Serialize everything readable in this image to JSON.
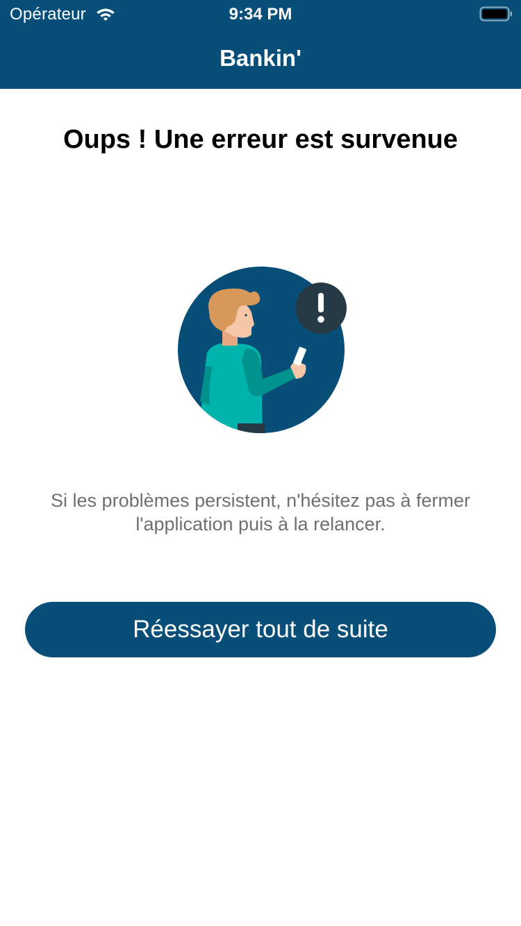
{
  "status_bar": {
    "carrier": "Opérateur",
    "time": "9:34 PM",
    "wifi_icon": "wifi-icon",
    "battery_icon": "battery-icon"
  },
  "nav": {
    "title": "Bankin'"
  },
  "error": {
    "title": "Oups ! Une erreur est survenue",
    "message_line1": "Si les problèmes persistent, n'hésitez pas à fermer",
    "message_line2": "l'application puis à la relancer.",
    "illustration_icon": "person-with-phone-illustration",
    "alert_icon": "exclamation-icon"
  },
  "actions": {
    "retry_label": "Réessayer tout de suite"
  },
  "colors": {
    "brand": "#074f79",
    "background": "#ffffff",
    "title_text": "#000000",
    "body_text": "#6f6f6f",
    "alert_badge": "#263a46"
  }
}
